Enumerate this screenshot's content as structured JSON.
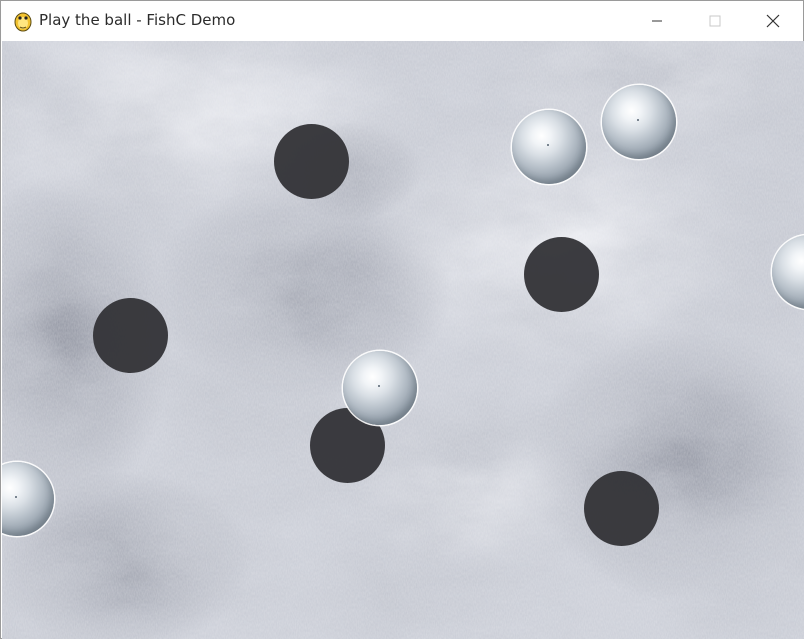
{
  "window": {
    "title": "Play the ball - FishC Demo",
    "app_icon": "pygame-snake-icon",
    "controls": {
      "minimize_icon": "minimize-icon",
      "maximize_icon": "maximize-icon",
      "close_icon": "close-icon"
    }
  },
  "game": {
    "background": "frosted-ice-texture",
    "ball_colors": {
      "white": "#d9dfe5",
      "black": "#343438"
    },
    "white_ball_count": 5,
    "black_ball_count": 5
  }
}
